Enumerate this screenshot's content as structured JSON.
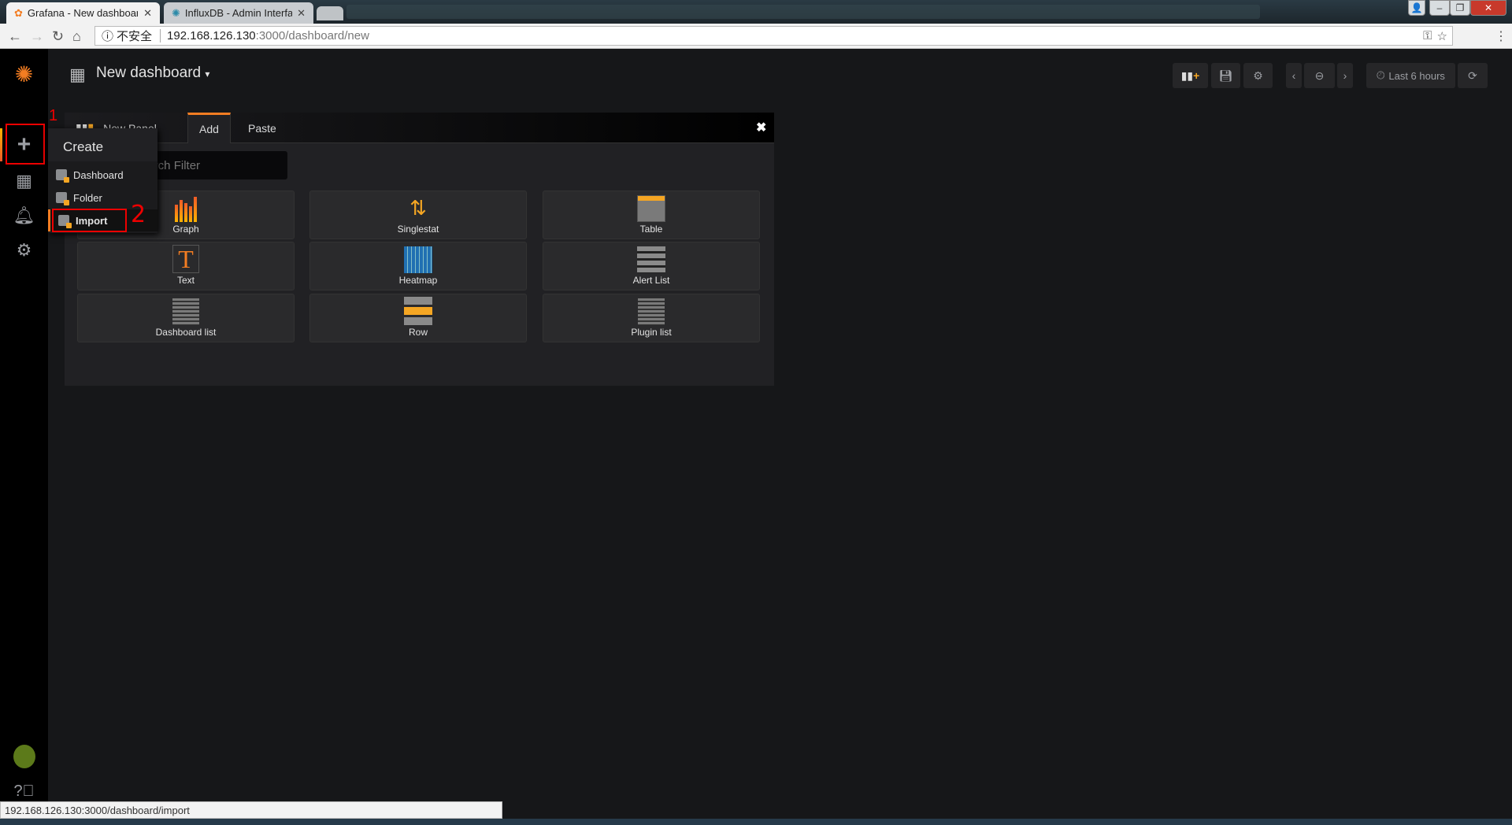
{
  "browser": {
    "tabs": [
      {
        "title": "Grafana - New dashboard",
        "icon": "grafana-icon"
      },
      {
        "title": "InfluxDB - Admin Interface",
        "icon": "influxdb-icon"
      }
    ],
    "security_label": "不安全",
    "url_host": "192.168.126.130",
    "url_path": ":3000/dashboard/new",
    "status_url": "192.168.126.130:3000/dashboard/import"
  },
  "sidebar": {
    "items": [
      "create",
      "dashboards",
      "alerting",
      "configuration"
    ],
    "bottom": [
      "profile",
      "help"
    ]
  },
  "header": {
    "title": "New dashboard",
    "time_range": "Last 6 hours"
  },
  "panel": {
    "tabs": [
      {
        "label": "New Panel"
      },
      {
        "label": "Add"
      },
      {
        "label": "Paste"
      }
    ],
    "filter_placeholder": "Search Filter",
    "items": [
      {
        "label": "Graph"
      },
      {
        "label": "Singlestat"
      },
      {
        "label": "Table"
      },
      {
        "label": "Text"
      },
      {
        "label": "Heatmap"
      },
      {
        "label": "Alert List"
      },
      {
        "label": "Dashboard list"
      },
      {
        "label": "Row"
      },
      {
        "label": "Plugin list"
      }
    ]
  },
  "create_menu": {
    "title": "Create",
    "items": [
      {
        "label": "Dashboard"
      },
      {
        "label": "Folder"
      },
      {
        "label": "Import"
      }
    ]
  },
  "annotations": {
    "one": "1",
    "two": "2"
  },
  "colors": {
    "accent": "#f37d22",
    "highlight": "#e00000"
  }
}
